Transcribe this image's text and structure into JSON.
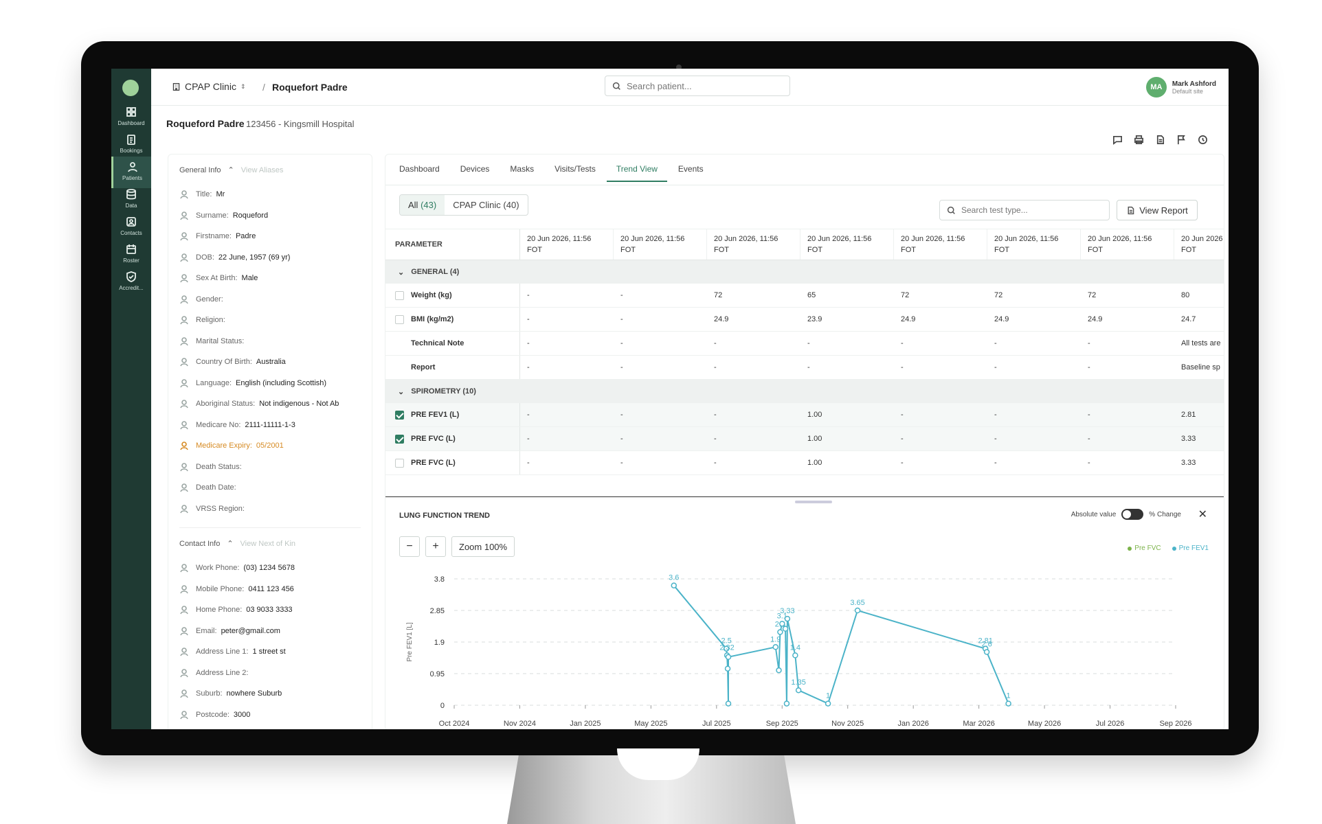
{
  "nav": [
    {
      "label": "Dashboard",
      "icon": "grid-icon"
    },
    {
      "label": "Bookings",
      "icon": "clipboard-icon"
    },
    {
      "label": "Patients",
      "icon": "person-icon",
      "active": true
    },
    {
      "label": "Data",
      "icon": "database-icon"
    },
    {
      "label": "Contacts",
      "icon": "contact-icon"
    },
    {
      "label": "Roster",
      "icon": "calendar-icon"
    },
    {
      "label": "Accredit...",
      "icon": "shield-icon"
    }
  ],
  "topbar": {
    "clinic": "CPAP Clinic",
    "separator": "/",
    "patient": "Roquefort Padre",
    "search_placeholder": "Search patient...",
    "user_initials": "MA",
    "user_name": "Mark Ashford",
    "user_site": "Default site"
  },
  "patient": {
    "name": "Roqueford Padre",
    "id": "123456 - Kingsmill Hospital"
  },
  "general": {
    "title": "General Info",
    "aliases": "View Aliases",
    "fields": [
      {
        "label": "Title:",
        "value": "Mr"
      },
      {
        "label": "Surname:",
        "value": "Roqueford"
      },
      {
        "label": "Firstname:",
        "value": "Padre"
      },
      {
        "label": "DOB:",
        "value": "22 June, 1957 (69 yr)"
      },
      {
        "label": "Sex At Birth:",
        "value": "Male"
      },
      {
        "label": "Gender:",
        "value": ""
      },
      {
        "label": "Religion:",
        "value": ""
      },
      {
        "label": "Marital Status:",
        "value": ""
      },
      {
        "label": "Country Of Birth:",
        "value": "Australia"
      },
      {
        "label": "Language:",
        "value": "English (including Scottish)"
      },
      {
        "label": "Aboriginal Status:",
        "value": "Not indigenous - Not Ab"
      },
      {
        "label": "Medicare No:",
        "value": "2111-11111-1-3"
      },
      {
        "label": "Medicare Expiry:",
        "value": "05/2001",
        "warn": true
      },
      {
        "label": "Death Status:",
        "value": ""
      },
      {
        "label": "Death Date:",
        "value": ""
      },
      {
        "label": "VRSS Region:",
        "value": ""
      }
    ]
  },
  "contact": {
    "title": "Contact Info",
    "kin": "View Next of Kin",
    "fields": [
      {
        "label": "Work Phone:",
        "value": "(03) 1234 5678"
      },
      {
        "label": "Mobile Phone:",
        "value": "0411 123 456"
      },
      {
        "label": "Home Phone:",
        "value": "03 9033 3333"
      },
      {
        "label": "Email:",
        "value": "peter@gmail.com"
      },
      {
        "label": "Address Line 1:",
        "value": "1 street st"
      },
      {
        "label": "Address Line 2:",
        "value": ""
      },
      {
        "label": "Suburb:",
        "value": "nowhere Suburb"
      },
      {
        "label": "Postcode:",
        "value": "3000"
      }
    ]
  },
  "tabs": [
    "Dashboard",
    "Devices",
    "Masks",
    "Visits/Tests",
    "Trend View",
    "Events"
  ],
  "active_tab": "Trend View",
  "filter": {
    "all": "All",
    "all_count": "(43)",
    "clinic": "CPAP Clinic (40)"
  },
  "search_test_placeholder": "Search test type...",
  "view_report": "View Report",
  "table": {
    "param_header": "PARAMETER",
    "columns": [
      {
        "date": "20 Jun 2026, 11:56",
        "type": "FOT"
      },
      {
        "date": "20 Jun 2026, 11:56",
        "type": "FOT"
      },
      {
        "date": "20 Jun 2026, 11:56",
        "type": "FOT"
      },
      {
        "date": "20 Jun 2026, 11:56",
        "type": "FOT"
      },
      {
        "date": "20 Jun 2026, 11:56",
        "type": "FOT"
      },
      {
        "date": "20 Jun 2026, 11:56",
        "type": "FOT"
      },
      {
        "date": "20 Jun 2026, 11:56",
        "type": "FOT"
      },
      {
        "date": "20 Jun 2026",
        "type": "FOT"
      }
    ],
    "groups": [
      {
        "title": "GENERAL (4)",
        "rows": [
          {
            "name": "Weight (kg)",
            "check": "off",
            "values": [
              "-",
              "-",
              "72",
              "65",
              "72",
              "72",
              "72",
              "80"
            ]
          },
          {
            "name": "BMI (kg/m2)",
            "check": "off",
            "values": [
              "-",
              "-",
              "24.9",
              "23.9",
              "24.9",
              "24.9",
              "24.9",
              "24.7"
            ]
          },
          {
            "name": "Technical Note",
            "check": "none",
            "values": [
              "-",
              "-",
              "-",
              "-",
              "-",
              "-",
              "-",
              "All tests are"
            ]
          },
          {
            "name": "Report",
            "check": "none",
            "values": [
              "-",
              "-",
              "-",
              "-",
              "-",
              "-",
              "-",
              "Baseline sp"
            ]
          }
        ]
      },
      {
        "title": "SPIROMETRY (10)",
        "rows": [
          {
            "name": "PRE FEV1 (L)",
            "check": "on",
            "values": [
              "-",
              "-",
              "-",
              "1.00",
              "-",
              "-",
              "-",
              "2.81"
            ]
          },
          {
            "name": "PRE FVC (L)",
            "check": "on",
            "values": [
              "-",
              "-",
              "-",
              "1.00",
              "-",
              "-",
              "-",
              "3.33"
            ]
          },
          {
            "name": "PRE FVC (L)",
            "check": "off",
            "values": [
              "-",
              "-",
              "-",
              "1.00",
              "-",
              "-",
              "-",
              "3.33"
            ]
          }
        ]
      }
    ]
  },
  "chart_panel": {
    "title": "LUNG FUNCTION TREND",
    "absolute": "Absolute value",
    "pct": "% Change",
    "zoom_out": "−",
    "zoom_in": "+",
    "zoom_label": "Zoom 100%",
    "close": "✕"
  },
  "colors": {
    "accent": "#2f7d62",
    "fvc": "#7cb34a",
    "fev1": "#4bb3c8"
  },
  "chart_data": {
    "type": "line",
    "ylabel": "Pre FEV1 [L]",
    "ylim": [
      0,
      3.8
    ],
    "yticks": [
      0,
      0.95,
      1.9,
      2.85,
      3.8
    ],
    "xticks": [
      "Oct 2024",
      "Nov 2024",
      "Jan 2025",
      "May 2025",
      "Jul 2025",
      "Sep 2025",
      "Nov 2025",
      "Jan 2026",
      "Mar 2026",
      "May 2026",
      "Jul 2026",
      "Sep 2026"
    ],
    "legend": "top-right",
    "series": [
      {
        "name": "Pre FVC",
        "color": "#7cb34a",
        "points": []
      },
      {
        "name": "Pre FEV1",
        "color": "#4bb3c8",
        "points": [
          {
            "x": 3.35,
            "y": 3.6,
            "label": "3.6"
          },
          {
            "x": 4.15,
            "y": 1.7,
            "label": "2.5"
          },
          {
            "x": 4.16,
            "y": 1.5,
            "label": "2.32"
          },
          {
            "x": 4.17,
            "y": 1.1,
            "label": ""
          },
          {
            "x": 4.18,
            "y": 0.05,
            "label": ""
          },
          {
            "x": 4.18,
            "y": 1.45,
            "label": ""
          },
          {
            "x": 4.9,
            "y": 1.75,
            "label": "1.9"
          },
          {
            "x": 4.95,
            "y": 1.05,
            "label": ""
          },
          {
            "x": 4.97,
            "y": 2.2,
            "label": "2.6"
          },
          {
            "x": 5.0,
            "y": 2.45,
            "label": "3.1"
          },
          {
            "x": 5.05,
            "y": 2.3,
            "label": ""
          },
          {
            "x": 5.07,
            "y": 0.05,
            "label": ""
          },
          {
            "x": 5.08,
            "y": 2.6,
            "label": "3.33"
          },
          {
            "x": 5.2,
            "y": 1.5,
            "label": "1.4"
          },
          {
            "x": 5.25,
            "y": 0.45,
            "label": "1.35"
          },
          {
            "x": 5.7,
            "y": 0.05,
            "label": "1"
          },
          {
            "x": 6.15,
            "y": 2.85,
            "label": "3.65"
          },
          {
            "x": 8.1,
            "y": 1.7,
            "label": "2.81"
          },
          {
            "x": 8.12,
            "y": 1.6,
            "label": "2.6"
          },
          {
            "x": 8.45,
            "y": 0.05,
            "label": "1"
          }
        ]
      }
    ]
  }
}
